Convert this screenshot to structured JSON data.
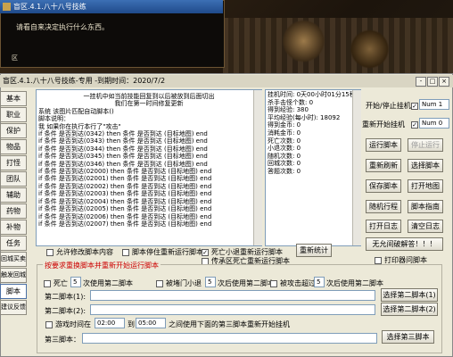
{
  "game": {
    "window_title": "盲区.4.1.八十八号技练",
    "dialog_text": "请看自来决定执行什么东西。",
    "link_text": "区"
  },
  "app": {
    "title": "盲区.4.1.八十八号技练-专用 -到期时间：2020/7/2",
    "window_buttons": [
      "-",
      "□",
      "×"
    ]
  },
  "sidebar": {
    "items": [
      "基本",
      "职业",
      "保护",
      "物品",
      "打怪",
      "团队",
      "辅助",
      "药物",
      "补物",
      "任务",
      "回城买卖",
      "触发回城",
      "脚本",
      "建议反馈"
    ],
    "selected": "脚本"
  },
  "log": {
    "lines": [
      "一挂机中如当前技能回复到以后被放到后面切出",
      "我们在第一时间修复更新",
      "",
      "系统 该图片匹配自动脚本()",
      "",
      "脚本说明：",
      "我 如果你在执行本行了\"攻击\"",
      "if 条件 是否到达(0342) then 条件 是否到达 (目标地图) end",
      "if 条件 是否到达(0343) then 条件 是否到达 (目标地图) end",
      "if 条件 是否到达(0344) then 条件 是否到达 (目标地图) end",
      "if 条件 是否到达(0345) then 条件 是否到达 (目标地图) end",
      "if 条件 是否到达(0346) then 条件 是否到达 (目标地图) end",
      "if 条件 是否到达(02000) then 条件 是否到达 (目标地图) end",
      "if 条件 是否到达(02001) then 条件 是否到达 (目标地图) end",
      "if 条件 是否到达(02002) then 条件 是否到达 (目标地图) end",
      "if 条件 是否到达(02003) then 条件 是否到达 (目标地图) end",
      "if 条件 是否到达(02004) then 条件 是否到达 (目标地图) end",
      "if 条件 是否到达(02005) then 条件 是否到达 (目标地图) end",
      "if 条件 是否到达(02006) then 条件 是否到达 (目标地图) end",
      "if 条件 是否到达(02007) then 条件 是否到达 (目标地图) end"
    ]
  },
  "status": {
    "lines": [
      "挂机时间: 0天00小时01分15秒",
      "杀手击怪个数: 0",
      "得到经验: 380",
      "平均经验(每小时): 18092",
      "得到金币: 0",
      "消耗金币: 0",
      "死亡次数: 0",
      "小退次数: 0",
      "随机次数: 0",
      "回城次数: 0",
      "答题次数: 0"
    ]
  },
  "controls": {
    "start_stop_label": "开始/停止挂机",
    "start_stop_hotkey": "Num 1",
    "restart_label": "重新开始挂机",
    "restart_hotkey": "Num 0",
    "buttons": {
      "run_script": "运行脚本",
      "stop_run": "停止运行",
      "reload_script": "重新刷新",
      "select_script": "选择脚本",
      "save_script": "保存脚本",
      "open_map": "打开地图",
      "random_move": "随机行程",
      "script_guide": "脚本指南",
      "open_log": "打开日志",
      "clear_log": "清空日志",
      "unlimited_crack": "无允间破解答！！！",
      "refresh_stats": "重新统计"
    },
    "auto_record_label": "打印器问脚本"
  },
  "options": {
    "allow_edit": "允许修改脚本内容",
    "stop_on_script": "脚本停住重新运行脚本",
    "stop_on_small_exit": "死亡小退重新运行脚本",
    "swap_save_script": "传承区死亡重新运行脚本"
  },
  "group": {
    "title": "按要求重换脚本并重新开始运行脚本",
    "death_prefix": "死亡",
    "death_count": "5",
    "death_suffix": "次使用第二脚本",
    "block_prefix": "被堵门小退",
    "block_count": "5",
    "block_suffix": "次后使用第二脚本",
    "attacked_prefix": "被攻击超过",
    "attacked_count": "5",
    "attacked_suffix": "次后使用第二脚本",
    "second_script_label": "第二脚本(1):",
    "second_script_label2": "第二脚本(2):",
    "select_second_1": "选择第二脚本(1)",
    "select_second_2": "选择第二脚本(2)",
    "time_prefix": "游戏时间在",
    "time_from": "02:00",
    "time_to_label": "到",
    "time_to": "05:00",
    "time_suffix": "之间使用下面的第三脚本重新开始挂机",
    "third_script_label": "第三脚本：",
    "select_third": "选择第三脚本"
  }
}
